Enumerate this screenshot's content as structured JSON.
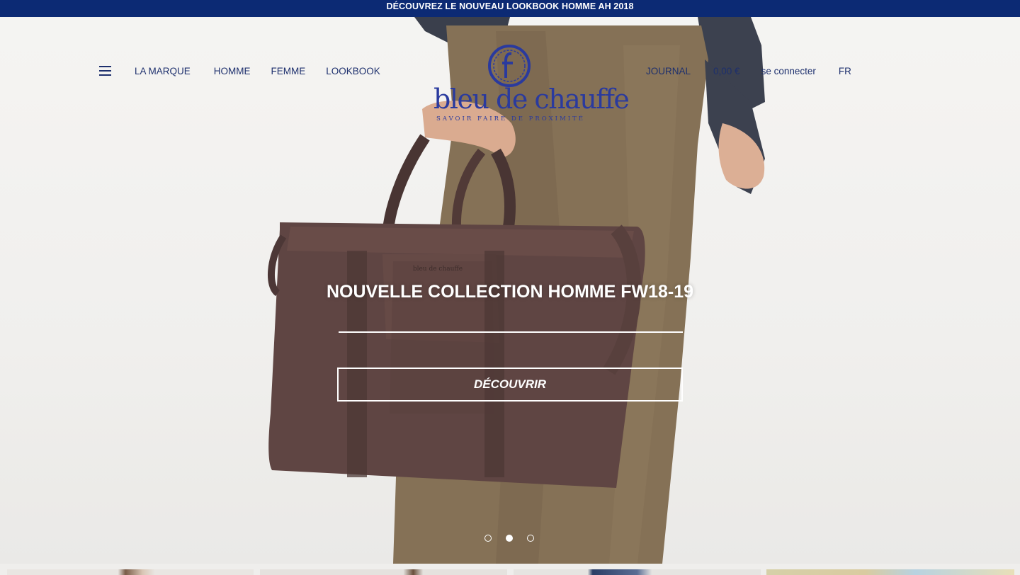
{
  "announcement": "DÉCOUVREZ LE NOUVEAU LOOKBOOK HOMME AH 2018",
  "nav_left": [
    {
      "label": "LA MARQUE"
    },
    {
      "label": "HOMME"
    },
    {
      "label": "FEMME"
    },
    {
      "label": "LOOKBOOK"
    }
  ],
  "nav_right": [
    {
      "label": "JOURNAL"
    },
    {
      "label": "0,00 €"
    },
    {
      "label": "se connecter"
    },
    {
      "label": "FR"
    }
  ],
  "logo": {
    "wordmark": "bleu de chauffe",
    "tagline": "SAVOIR FAIRE DE PROXIMITÉ",
    "bag_stamp": "bleu de chauffe"
  },
  "hero": {
    "title": "NOUVELLE COLLECTION HOMME FW18-19",
    "cta": "DÉCOUVRIR",
    "slides_total": 3,
    "active_slide": 2
  },
  "colors": {
    "brand_navy": "#0c2a74",
    "nav_text": "#1d2f6d",
    "logo_blue": "#2a3a9e",
    "background": "#efeeec"
  },
  "icons": [
    "hamburger-menu-icon",
    "logo-emblem-icon"
  ]
}
